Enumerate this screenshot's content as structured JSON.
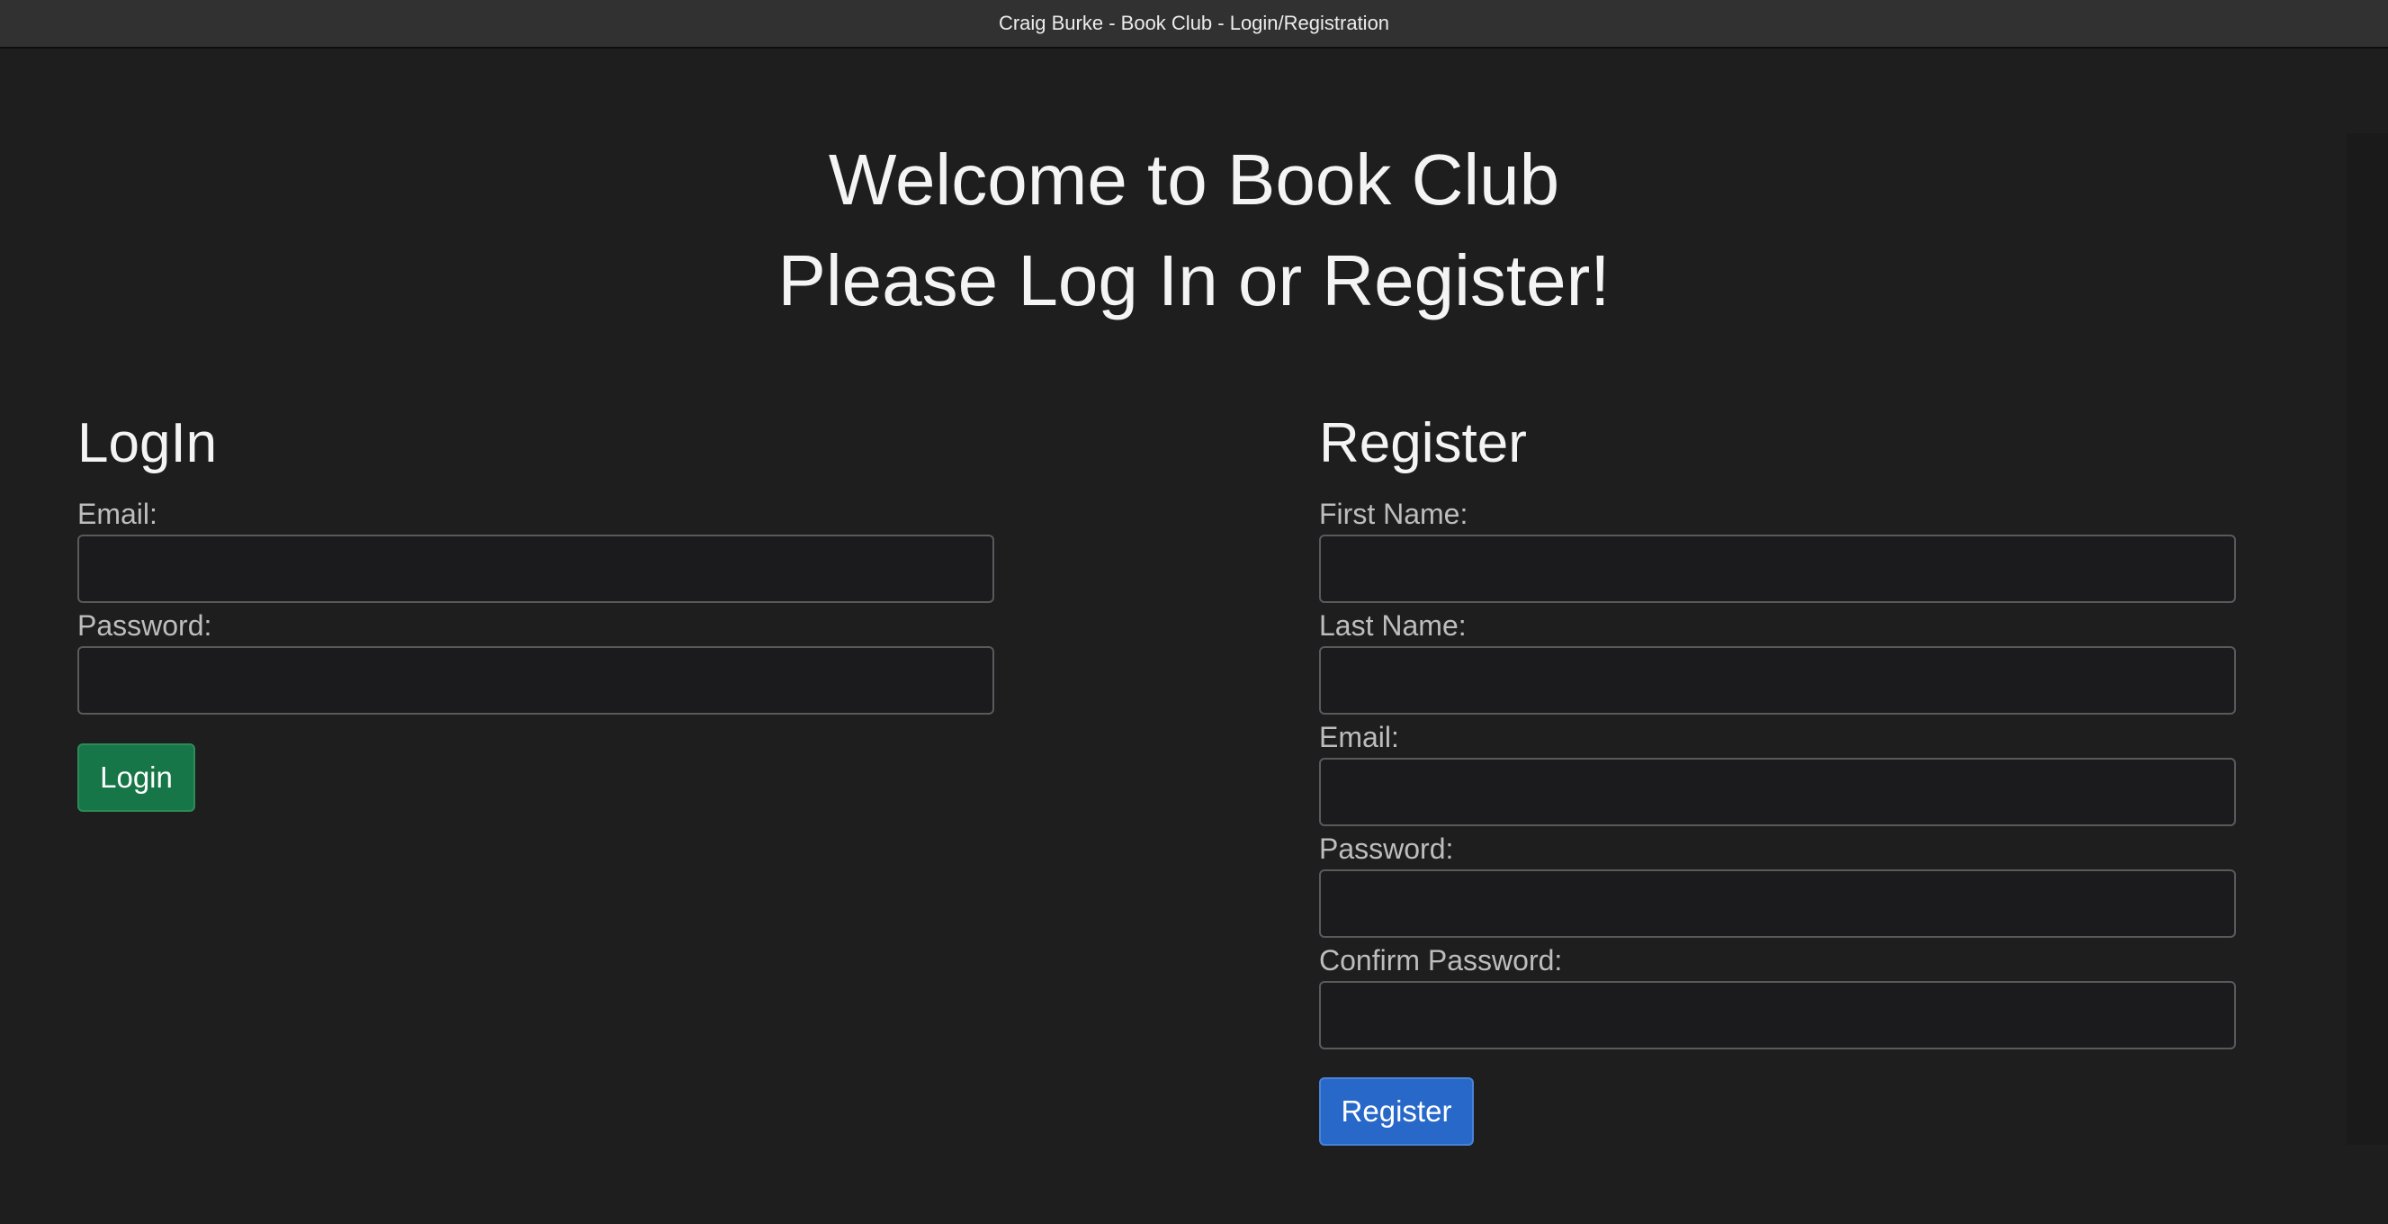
{
  "window": {
    "title": "Craig Burke - Book Club - Login/Registration"
  },
  "header": {
    "welcome": "Welcome to Book Club",
    "prompt": "Please Log In or Register!"
  },
  "login": {
    "title": "LogIn",
    "email_label": "Email:",
    "email_value": "",
    "password_label": "Password:",
    "password_value": "",
    "submit_label": "Login",
    "submit_color": "#177648"
  },
  "register": {
    "title": "Register",
    "first_name_label": "First Name:",
    "first_name_value": "",
    "last_name_label": "Last Name:",
    "last_name_value": "",
    "email_label": "Email:",
    "email_value": "",
    "password_label": "Password:",
    "password_value": "",
    "confirm_password_label": "Confirm Password:",
    "confirm_password_value": "",
    "submit_label": "Register",
    "submit_color": "#2768c9"
  },
  "theme": {
    "background": "#1e1e1f",
    "titlebar": "#313132"
  }
}
